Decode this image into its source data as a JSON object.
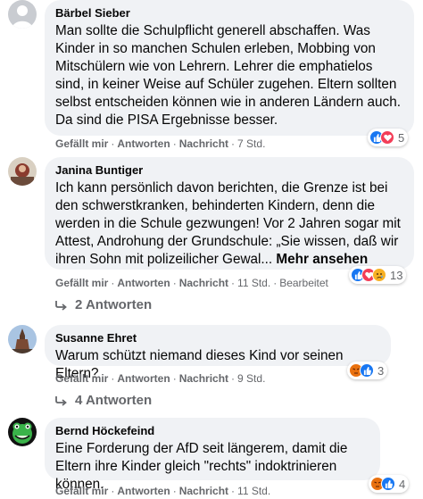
{
  "actions": {
    "like": "Gefällt mir",
    "reply": "Antworten",
    "message": "Nachricht",
    "separator": "·"
  },
  "comments": [
    {
      "author": "Bärbel Sieber",
      "text": "Man sollte die Schulpflicht generell abschaffen. Was Kinder in so manchen Schulen erleben, Mobbing von Mitschülern wie von Lehrern. Lehrer die emphatielos sind, in keiner Weise auf Schüler zugehen. Eltern sollten selbst entscheiden können wie in anderen Ländern auch. Da sind die PISA Ergebnisse besser.",
      "time": "7 Std.",
      "reactions": {
        "icons": [
          "like-icon",
          "love-icon"
        ],
        "count": "5"
      }
    },
    {
      "author": "Janina Buntiger",
      "text": "Ich kann persönlich davon berichten, die Grenze ist bei den schwerstkranken, behinderten Kindern, denn die werden in die Schule gezwungen! Vor 2 Jahren sogar mit Attest, Androhung der Grundschule: „Sie wissen, daß wir ihren Sohn mit polizeilicher Gewal...",
      "more": "Mehr ansehen",
      "time": "11 Std.",
      "edited": "Bearbeitet",
      "reactions": {
        "icons": [
          "like-icon",
          "love-icon",
          "sad-icon"
        ],
        "count": "13"
      },
      "replies": "2 Antworten"
    },
    {
      "author": "Susanne Ehret",
      "text": "Warum schützt niemand dieses Kind vor seinen Eltern?",
      "time": "9 Std.",
      "reactions": {
        "icons": [
          "angry-icon",
          "like-icon"
        ],
        "count": "3"
      },
      "replies": "4 Antworten"
    },
    {
      "author": "Bernd Höckefeind",
      "text": "Eine Forderung der AfD seit längerem, damit die Eltern ihre Kinder gleich \"rechts\" indoktrinieren können.",
      "time": "11 Std.",
      "reactions": {
        "icons": [
          "angry-icon",
          "like-icon"
        ],
        "count": "4"
      }
    }
  ],
  "colors": {
    "bubble": "#f0f2f5",
    "meta_text": "#65676b",
    "like": "#1877f2",
    "love": "#f33e58",
    "sad_angry": "#f7b125",
    "angry": "#e9710f"
  }
}
